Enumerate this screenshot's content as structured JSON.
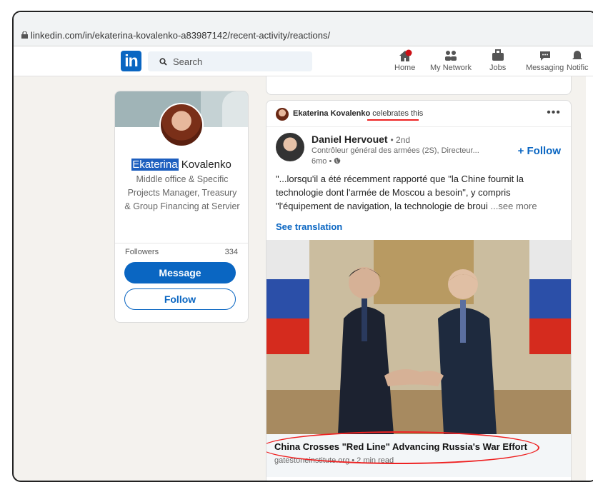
{
  "browser": {
    "url": "linkedin.com/in/ekaterina-kovalenko-a83987142/recent-activity/reactions/"
  },
  "nav": {
    "search_placeholder": "Search",
    "items": [
      {
        "label": "Home",
        "icon": "home-icon"
      },
      {
        "label": "My Network",
        "icon": "network-icon"
      },
      {
        "label": "Jobs",
        "icon": "jobs-icon"
      },
      {
        "label": "Messaging",
        "icon": "messaging-icon"
      },
      {
        "label": "Notific",
        "icon": "notifications-icon"
      }
    ]
  },
  "profile": {
    "first_name": "Ekaterina",
    "last_name": "Kovalenko",
    "headline": "Middle office & Specific Projects Manager, Treasury & Group Financing at Servier",
    "followers_label": "Followers",
    "followers_count": "334",
    "message_label": "Message",
    "follow_label": "Follow"
  },
  "post": {
    "actor_name": "Ekaterina Kovalenko",
    "actor_action": "celebrates",
    "actor_suffix": "this",
    "more_options": "•••",
    "author_name": "Daniel Hervouet",
    "author_degree": "• 2nd",
    "author_headline": "Contrôleur général des armées (2S), Directeur...",
    "author_time": "6mo •",
    "follow_label": "+ Follow",
    "body_text": "\"...lorsqu'il a été récemment rapporté que \"la Chine fournit la technologie dont l'armée de Moscou a besoin\", y compris \"l'équipement de navigation, la technologie de broui",
    "see_more": "...see more",
    "see_translation": "See translation",
    "link_title": "China Crosses \"Red Line\" Advancing Russia's War Effort",
    "link_source": "gatestoneinstitute.org • 2 min read"
  },
  "colors": {
    "brand": "#0a66c2",
    "annotation": "#e22222"
  }
}
